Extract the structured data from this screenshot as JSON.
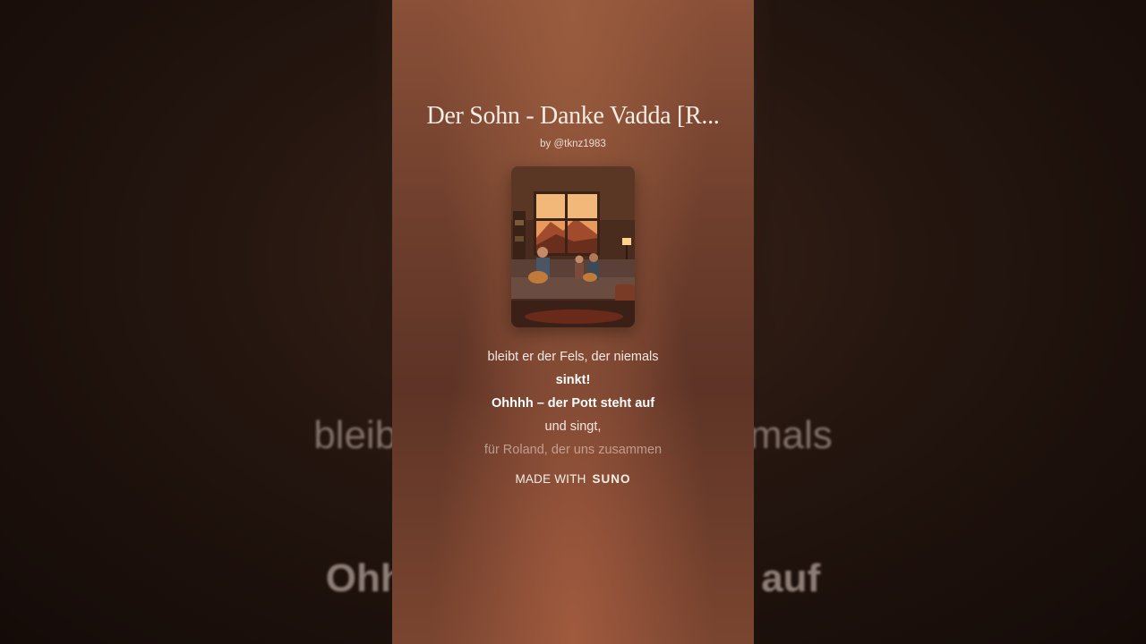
{
  "song": {
    "title": "Der Sohn - Danke Vadda [R...",
    "artist": "by @tknz1983"
  },
  "cover": {
    "icon": "album-cover-image"
  },
  "lyrics": [
    {
      "text": "bleibt er der Fels, der niemals",
      "style": "normal"
    },
    {
      "text": "sinkt!",
      "style": "bold"
    },
    {
      "text": "Ohhhh – der Pott steht auf",
      "style": "bold"
    },
    {
      "text": "und singt,",
      "style": "normal"
    },
    {
      "text": "für Roland, der uns zusammen",
      "style": "faded"
    }
  ],
  "footer": {
    "prefix": "MADE WITH",
    "brand": "SUNO"
  },
  "background": {
    "line1": "bleibt er der Fels, der niemals",
    "line2": "Ohhhh – der Pott steht auf"
  }
}
